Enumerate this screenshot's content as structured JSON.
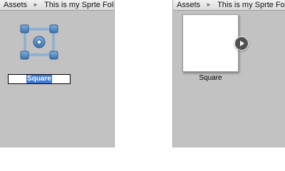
{
  "left_panel": {
    "breadcrumb": {
      "root": "Assets",
      "separator": "►",
      "folder": "This is my Sprte Folder"
    },
    "sprite": {
      "icon": "sprite-editor-icon",
      "rename_value": "Square"
    }
  },
  "right_panel": {
    "breadcrumb": {
      "root": "Assets",
      "separator": "►",
      "folder": "This is my Sprte Folder"
    },
    "sprite": {
      "icon": "play-icon",
      "label": "Square"
    }
  },
  "colors": {
    "panel_bg": "#c2c2c2",
    "selection": "#3f7ad8",
    "icon_blue": "#5b8fc4"
  }
}
